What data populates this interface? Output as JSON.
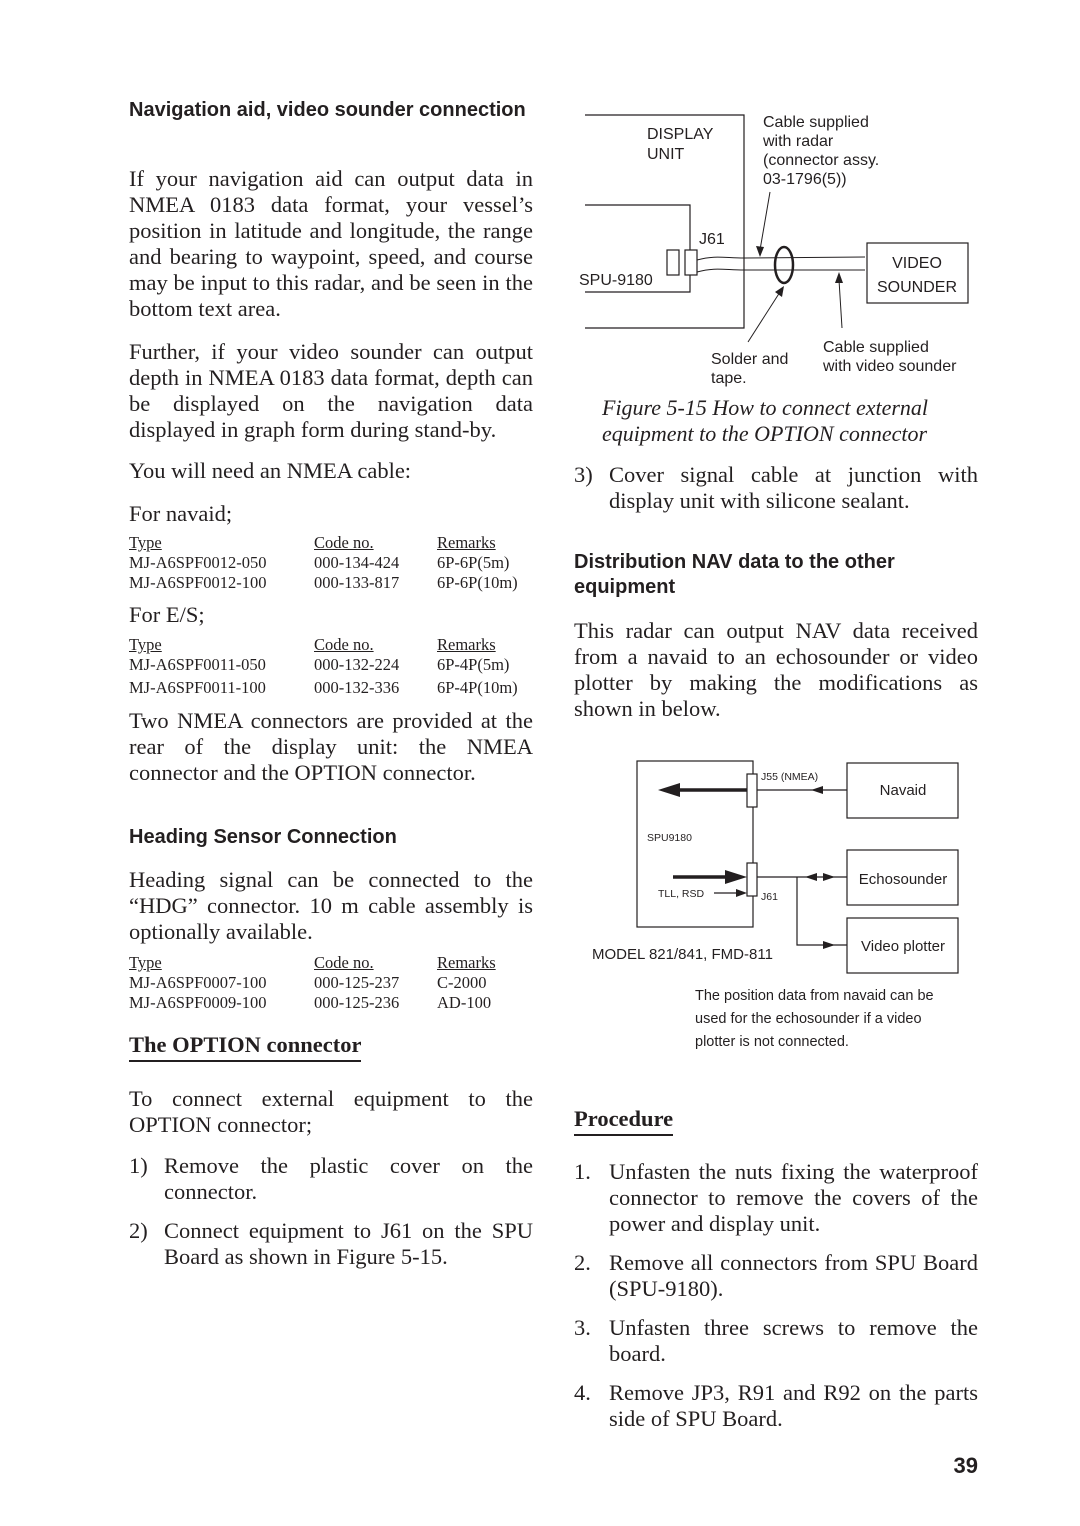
{
  "left": {
    "nav_heading": "Navigation aid, video sounder connection",
    "nav_para1": "If your navigation aid can output data in NMEA 0183 data format, your vessel’s position in latitude and longitude, the range and bearing to waypoint, speed, and course may be input to this radar, and be seen in the bottom text area.",
    "nav_para2": "Further, if your video sounder can output depth in NMEA 0183 data format, depth can be displayed on the navigation data displayed in graph form during stand-by.",
    "need_cable": "You will need an NMEA cable:",
    "for_navaid": "For navaid;",
    "table_headers": [
      "Type",
      "Code no.",
      "Remarks"
    ],
    "navaid_rows": [
      [
        "MJ-A6SPF0012-050",
        "000-134-424",
        "6P-6P(5m)"
      ],
      [
        "MJ-A6SPF0012-100",
        "000-133-817",
        "6P-6P(10m)"
      ]
    ],
    "for_es": "For E/S;",
    "es_rows": [
      [
        "MJ-A6SPF0011-050",
        "000-132-224",
        "6P-4P(5m)"
      ],
      [
        "MJ-A6SPF0011-100",
        "000-132-336",
        "6P-4P(10m)"
      ]
    ],
    "two_connectors": "Two NMEA connectors are provided at the rear of the display unit: the NMEA connector and the OPTION connector.",
    "heading_heading": "Heading Sensor Connection",
    "heading_para": "Heading signal can be connected to the “HDG” connector. 10 m cable assembly is optionally available.",
    "heading_rows": [
      [
        "MJ-A6SPF0007-100",
        "000-125-237",
        "C-2000"
      ],
      [
        "MJ-A6SPF0009-100",
        "000-125-236",
        "AD-100"
      ]
    ],
    "option_heading": "The OPTION connector",
    "option_para": "To connect external equipment to the OPTION connector;",
    "option_steps": [
      {
        "num": "1)",
        "text": "Remove the plastic cover on the connector."
      },
      {
        "num": "2)",
        "text": "Connect equipment to J61 on the SPU Board as shown in Figure 5-15."
      }
    ]
  },
  "right": {
    "fig1": {
      "display_unit": [
        "DISPLAY",
        "UNIT"
      ],
      "cable_radar": [
        "Cable supplied",
        "with radar",
        "(connector assy.",
        "03-1796(5))"
      ],
      "j61": "J61",
      "spu": "SPU-9180",
      "video_sounder": [
        "VIDEO",
        "SOUNDER"
      ],
      "solder": [
        "Solder and",
        "tape."
      ],
      "cable_sounder": [
        "Cable supplied",
        "with video sounder"
      ]
    },
    "fig1_caption": [
      "Figure 5-15 How to connect external",
      "equipment to the OPTION connector"
    ],
    "step3": {
      "num": "3)",
      "text": "Cover signal cable at junction with display unit with silicone sealant."
    },
    "dist_heading": "Distribution NAV data to the other equipment",
    "dist_para": "This radar can output NAV data received from a navaid to an echosounder or video plotter by making the modifications as shown in below.",
    "fig2": {
      "j55": "J55 (NMEA)",
      "navaid": "Navaid",
      "spu": "SPU9180",
      "echosounder": "Echosounder",
      "tll": "TLL, RSD",
      "j61": "J61",
      "video_plotter": "Video plotter",
      "model": "MODEL 821/841, FMD-811"
    },
    "fig2_note": [
      "The position data from navaid can be",
      "used for the echosounder if a video",
      "plotter is not connected."
    ],
    "procedure_heading": "Procedure",
    "procedure_steps": [
      {
        "num": "1.",
        "text": "Unfasten the nuts fixing the waterproof connector to remove the covers of the power and display unit."
      },
      {
        "num": "2.",
        "text": "Remove all connectors from SPU Board (SPU-9180)."
      },
      {
        "num": "3.",
        "text": "Unfasten three screws to remove the board."
      },
      {
        "num": "4.",
        "text": "Remove JP3, R91 and R92 on the parts side of SPU Board."
      }
    ]
  },
  "page_number": "39"
}
